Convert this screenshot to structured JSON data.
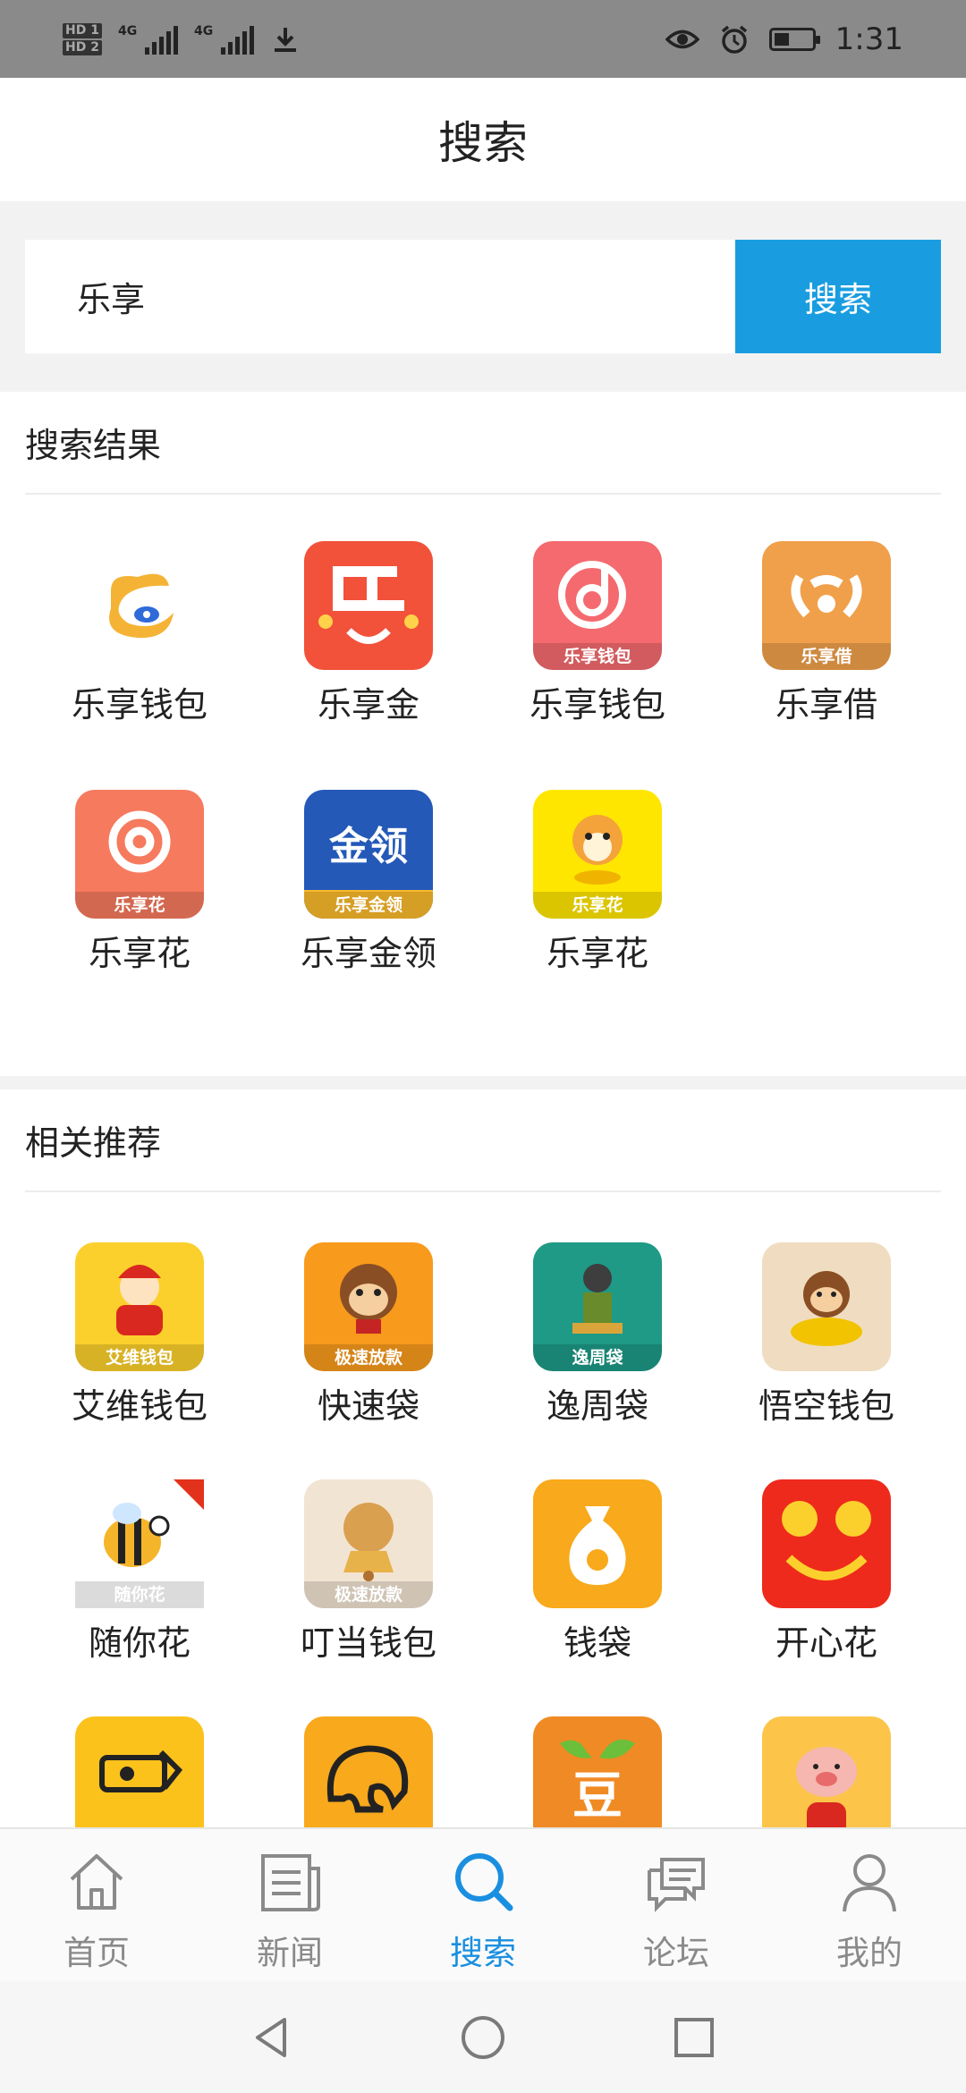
{
  "status_bar": {
    "hd1": "HD 1",
    "hd2": "HD 2",
    "net1": "4G",
    "net2": "4G",
    "time": "1:31",
    "battery_fraction": 0.4
  },
  "header": {
    "title": "搜索"
  },
  "search": {
    "value": "乐享",
    "button_label": "搜索"
  },
  "results": {
    "heading": "搜索结果",
    "apps": [
      {
        "name": "乐享钱包",
        "icon": "swirl-coin-logo-icon",
        "bg": "#ffffff",
        "fg": "#f5b335",
        "badge": ""
      },
      {
        "name": "乐享金",
        "icon": "le-smile-logo-icon",
        "bg": "#f2513a",
        "fg": "#ffffff",
        "badge": ""
      },
      {
        "name": "乐享钱包",
        "icon": "music-note-d-logo-icon",
        "bg": "#f46a6e",
        "fg": "#ffffff",
        "badge": "乐享钱包"
      },
      {
        "name": "乐享借",
        "icon": "wifi-coin-logo-icon",
        "bg": "#f0a04b",
        "fg": "#ffffff",
        "badge": "乐享借"
      },
      {
        "name": "乐享花",
        "icon": "flower-logo-icon",
        "bg": "#f67a5e",
        "fg": "#ffffff",
        "badge": "乐享花"
      },
      {
        "name": "乐享金领",
        "icon": "jinling-logo-icon",
        "bg": "#2459b8",
        "fg": "#ffffff",
        "badge": "乐享金领"
      },
      {
        "name": "乐享花",
        "icon": "shiba-dog-logo-icon",
        "bg": "#ffe600",
        "fg": "#e3221b",
        "badge": "乐享花"
      }
    ]
  },
  "recommend": {
    "heading": "相关推荐",
    "apps": [
      {
        "name": "艾维钱包",
        "icon": "fortune-god-logo-icon",
        "bg": "#fcd02c",
        "fg": "#d9281f",
        "badge": "艾维钱包"
      },
      {
        "name": "快速袋",
        "icon": "monkey-logo-icon",
        "bg": "#f89a1c",
        "fg": "#c42424",
        "badge": "极速放款"
      },
      {
        "name": "逸周袋",
        "icon": "warrior-logo-icon",
        "bg": "#1e9a86",
        "fg": "#ffffff",
        "badge": "逸周袋"
      },
      {
        "name": "悟空钱包",
        "icon": "monkey-king-logo-icon",
        "bg": "#f0dcc0",
        "fg": "#f2c300",
        "badge": ""
      },
      {
        "name": "随你花",
        "icon": "bee-logo-icon",
        "bg": "#ffffff",
        "fg": "#f5b52a",
        "badge": "随你花"
      },
      {
        "name": "叮当钱包",
        "icon": "bell-ox-logo-icon",
        "bg": "#f2e4d2",
        "fg": "#d9a050",
        "badge": "极速放款"
      },
      {
        "name": "钱袋",
        "icon": "money-bag-logo-icon",
        "bg": "#f8a91c",
        "fg": "#ffffff",
        "badge": ""
      },
      {
        "name": "开心花",
        "icon": "smile-coins-logo-icon",
        "bg": "#ee2a1c",
        "fg": "#fcd02c",
        "badge": ""
      },
      {
        "name": "",
        "icon": "cash-hand-logo-icon",
        "bg": "#fcc21c",
        "fg": "#222222",
        "badge": ""
      },
      {
        "name": "",
        "icon": "elephant-logo-icon",
        "bg": "#f8a91c",
        "fg": "#222222",
        "badge": ""
      },
      {
        "name": "",
        "icon": "bean-sprout-logo-icon",
        "bg": "#f08a24",
        "fg": "#ffffff",
        "badge": ""
      },
      {
        "name": "",
        "icon": "pig-logo-icon",
        "bg": "#fcc54a",
        "fg": "#e86b6b",
        "badge": ""
      }
    ]
  },
  "bottom_nav": [
    {
      "label": "首页",
      "icon": "home-icon",
      "active": false
    },
    {
      "label": "新闻",
      "icon": "news-icon",
      "active": false
    },
    {
      "label": "搜索",
      "icon": "search-icon",
      "active": true
    },
    {
      "label": "论坛",
      "icon": "forum-icon",
      "active": false
    },
    {
      "label": "我的",
      "icon": "profile-icon",
      "active": false
    }
  ],
  "colors": {
    "accent": "#1a9de0",
    "nav_active": "#1a8fe0",
    "nav_inactive": "#8a8a8a"
  }
}
